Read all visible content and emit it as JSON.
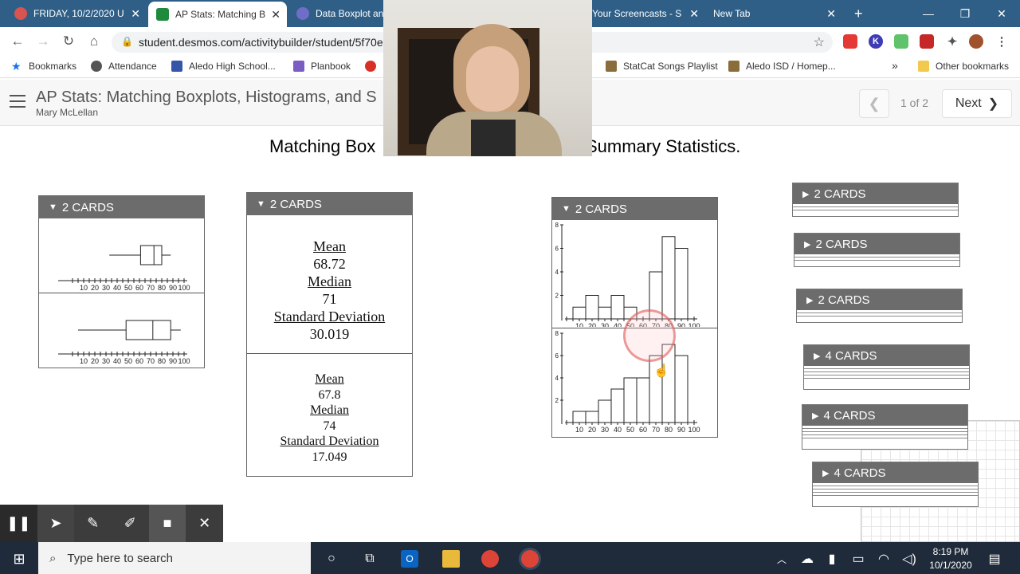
{
  "browser": {
    "tabs": [
      {
        "label": "FRIDAY, 10/2/2020 U",
        "icon": "recording-icon",
        "color": "#d9534f"
      },
      {
        "label": "AP Stats: Matching B",
        "icon": "desmos-icon",
        "color": "#1e8a3e"
      },
      {
        "label": "Data Boxplot and",
        "icon": "screencast-icon",
        "color": "#6e6ec8"
      },
      {
        "label": "Your Screencasts - S",
        "icon": "screencast-icon",
        "color": "#3b8ed6"
      },
      {
        "label": "New Tab",
        "icon": "chrome-icon",
        "color": "#dddddd"
      }
    ],
    "url": "student.desmos.com/activitybuilder/student/5f70e",
    "bookmarks": [
      {
        "label": "Bookmarks",
        "color": "#1a73e8"
      },
      {
        "label": "Attendance",
        "color": "#555555"
      },
      {
        "label": "Aledo High School...",
        "color": "#3556a8"
      },
      {
        "label": "Planbook",
        "color": "#7a5cc2"
      },
      {
        "label": "",
        "color": "#d93025"
      },
      {
        "label": "StatCat Songs Playlist",
        "color": "#8a6d3b"
      },
      {
        "label": "Aledo ISD / Homep...",
        "color": "#8a6d3b"
      },
      {
        "label": "»",
        "color": ""
      },
      {
        "label": "Other bookmarks",
        "color": "#f2c94c"
      }
    ]
  },
  "app": {
    "title": "AP Stats: Matching Boxplots, Histograms, and S",
    "author": "Mary McLellan",
    "page_indicator": "1 of 2",
    "next_label": "Next",
    "prompt_left": "Matching Box",
    "prompt_right": "Summary Statistics."
  },
  "groups": {
    "boxplots": {
      "header": "2 CARDS",
      "axis_ticks": [
        "10",
        "20",
        "30",
        "40",
        "50",
        "60",
        "70",
        "80",
        "90",
        "100"
      ],
      "plots": [
        {
          "min": 33,
          "q1": 61,
          "median": 73,
          "q3": 80,
          "max": 88
        },
        {
          "min": 5,
          "q1": 48,
          "median": 72,
          "q3": 88,
          "max": 97
        }
      ]
    },
    "stats": {
      "header": "2 CARDS",
      "cards": [
        {
          "mean_label": "Mean",
          "mean": "68.72",
          "median_label": "Median",
          "median": "71",
          "sd_label": "Standard Deviation",
          "sd": "30.019"
        },
        {
          "mean_label": "Mean",
          "mean": "67.8",
          "median_label": "Median",
          "median": "74",
          "sd_label": "Standard Deviation",
          "sd": "17.049"
        }
      ]
    },
    "histograms": {
      "header": "2 CARDS",
      "axis_ticks": [
        "10",
        "20",
        "30",
        "40",
        "50",
        "60",
        "70",
        "80",
        "90",
        "100"
      ],
      "y_ticks": [
        "2",
        "4",
        "6",
        "8"
      ],
      "plots": [
        {
          "counts": [
            1,
            2,
            1,
            2,
            1,
            0,
            4,
            7,
            6
          ],
          "ymax": 8
        },
        {
          "counts": [
            1,
            1,
            2,
            3,
            4,
            4,
            6,
            7,
            6
          ],
          "ymax": 8
        }
      ]
    },
    "collapsed": [
      {
        "header": "2 CARDS"
      },
      {
        "header": "2 CARDS"
      },
      {
        "header": "2 CARDS"
      },
      {
        "header": "4 CARDS"
      },
      {
        "header": "4 CARDS"
      },
      {
        "header": "4 CARDS"
      }
    ]
  },
  "recorder": {
    "buttons": [
      "pause-icon",
      "pointer-icon",
      "pen-icon",
      "highlighter-icon",
      "camera-icon",
      "close-icon"
    ]
  },
  "taskbar": {
    "search_placeholder": "Type here to search",
    "time": "8:19 PM",
    "date": "10/1/2020"
  }
}
